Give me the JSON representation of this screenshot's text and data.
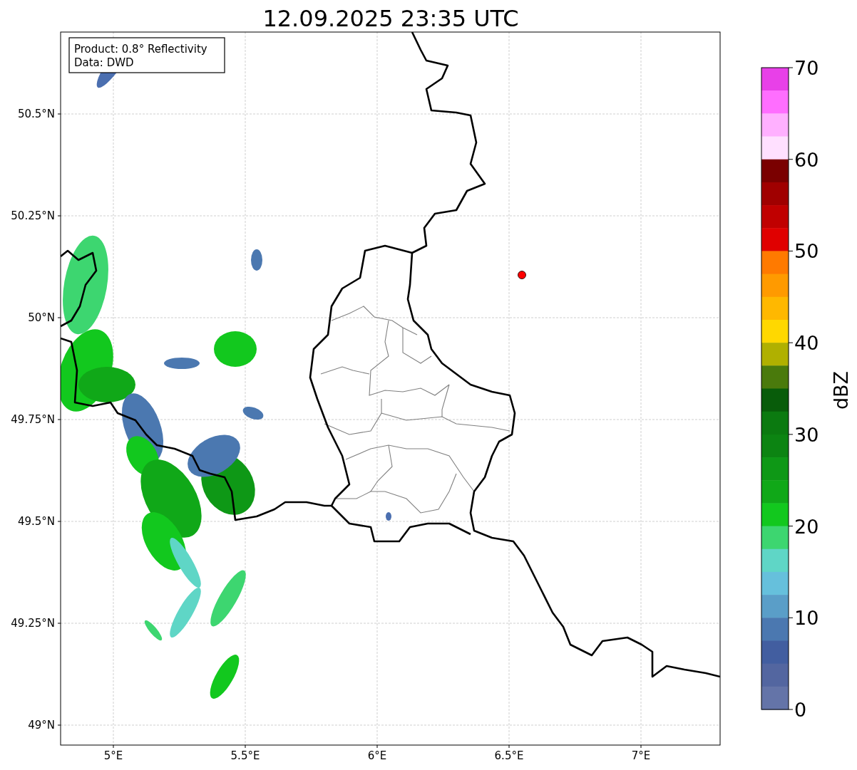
{
  "title": "12.09.2025 23:35 UTC",
  "map": {
    "info_box": [
      "Product: 0.8° Reflectivity",
      "Data: DWD"
    ],
    "lat_labels": [
      "50.5°N",
      "50.25°N",
      "50°N",
      "49.75°N",
      "49.5°N",
      "49.25°N",
      "49°N"
    ],
    "lon_labels": [
      "5°E",
      "5.5°E",
      "6°E",
      "6.5°E",
      "7°E"
    ]
  },
  "colorbar": {
    "label": "dBZ",
    "ticks": [
      "70",
      "60",
      "50",
      "40",
      "30",
      "20",
      "10",
      "0"
    ],
    "segments": [
      {
        "color": "#e840e8"
      },
      {
        "color": "#ff6eff"
      },
      {
        "color": "#ffb0ff"
      },
      {
        "color": "#ffe0ff"
      },
      {
        "color": "#7a0000"
      },
      {
        "color": "#a00000"
      },
      {
        "color": "#c00000"
      },
      {
        "color": "#e00000"
      },
      {
        "color": "#ff7a00"
      },
      {
        "color": "#ff9a00"
      },
      {
        "color": "#ffb800"
      },
      {
        "color": "#ffd800"
      },
      {
        "color": "#b0b000"
      },
      {
        "color": "#4a7a0c"
      },
      {
        "color": "#085c0a"
      },
      {
        "color": "#0b7a10"
      },
      {
        "color": "#0c8412"
      },
      {
        "color": "#0e9816"
      },
      {
        "color": "#10a818"
      },
      {
        "color": "#12c81e"
      },
      {
        "color": "#3dd670"
      },
      {
        "color": "#5fd6c6"
      },
      {
        "color": "#66c0dc"
      },
      {
        "color": "#5a9ec8"
      },
      {
        "color": "#4b78b0"
      },
      {
        "color": "#425ea0"
      },
      {
        "color": "#5366a0"
      },
      {
        "color": "#6474a8"
      }
    ]
  }
}
